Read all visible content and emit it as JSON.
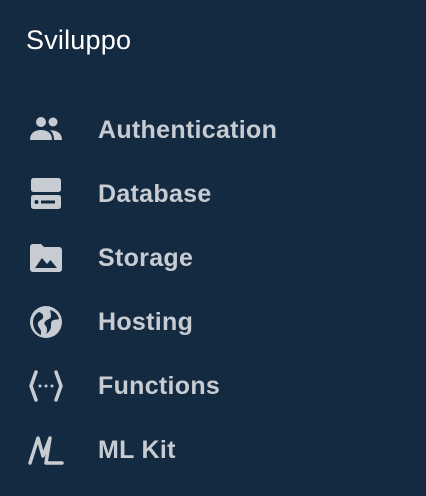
{
  "section": {
    "title": "Sviluppo"
  },
  "menu": {
    "items": [
      {
        "label": "Authentication",
        "icon": "people-icon"
      },
      {
        "label": "Database",
        "icon": "database-icon"
      },
      {
        "label": "Storage",
        "icon": "image-folder-icon"
      },
      {
        "label": "Hosting",
        "icon": "globe-icon"
      },
      {
        "label": "Functions",
        "icon": "functions-icon"
      },
      {
        "label": "ML Kit",
        "icon": "ml-kit-icon"
      }
    ]
  },
  "colors": {
    "background": "#132a40",
    "title": "#ffffff",
    "item_text": "#c7ccd2"
  }
}
